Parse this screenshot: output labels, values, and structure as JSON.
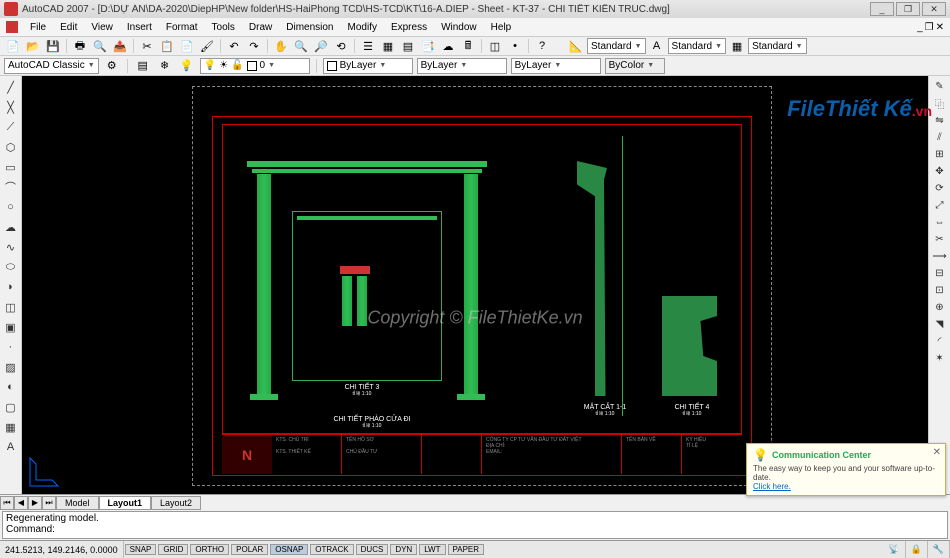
{
  "titlebar": {
    "title": "AutoCAD 2007 - [D:\\DỰ ÁN\\DA-2020\\DiepHP\\New folder\\HS-HaiPhong TCD\\HS-TCD\\KT\\16-A.DIEP - Sheet - KT-37 - CHI TIẾT KIẾN TRÚC.dwg]",
    "min": "_",
    "max": "❐",
    "close": "✕"
  },
  "menu": [
    "File",
    "Edit",
    "View",
    "Insert",
    "Format",
    "Tools",
    "Draw",
    "Dimension",
    "Modify",
    "Express",
    "Window",
    "Help"
  ],
  "toolbar1": {
    "style_std": "Standard",
    "style_std2": "Standard",
    "style_std3": "Standard"
  },
  "toolbar2": {
    "classic": "AutoCAD Classic",
    "layer0": "0",
    "bylayer1": "ByLayer",
    "bylayer2": "ByLayer",
    "bylayer3": "ByLayer",
    "bycolor": "ByColor"
  },
  "tabs": {
    "model": "Model",
    "layout1": "Layout1",
    "layout2": "Layout2"
  },
  "command": {
    "line1": "Regenerating model.",
    "line2": "Command:"
  },
  "status": {
    "coords": "241.5213, 149.2146, 0.0000",
    "toggles": [
      "SNAP",
      "GRID",
      "ORTHO",
      "POLAR",
      "OSNAP",
      "OTRACK",
      "DUCS",
      "DYN",
      "LWT",
      "PAPER"
    ]
  },
  "drawing": {
    "detail3": "CHI TIẾT 3",
    "detail3_scale": "tỉ lệ 1:10",
    "main_title": "CHI TIẾT PHÀO CỬA ĐI",
    "main_scale": "tỉ lệ 1:10",
    "section": "MẶT CẮT 1-1",
    "section_scale": "tỉ lệ 1:10",
    "detail4": "CHI TIẾT 4",
    "detail4_scale": "tỉ lệ 1:10"
  },
  "comm": {
    "title": "Communication Center",
    "body": "The easy way to keep you and your software up-to-date.",
    "link": "Click here."
  },
  "watermark": {
    "logo_a": "File",
    "logo_b": "Thiết Kế",
    "logo_c": ".vn",
    "center": "Copyright © FileThietKe.vn"
  }
}
